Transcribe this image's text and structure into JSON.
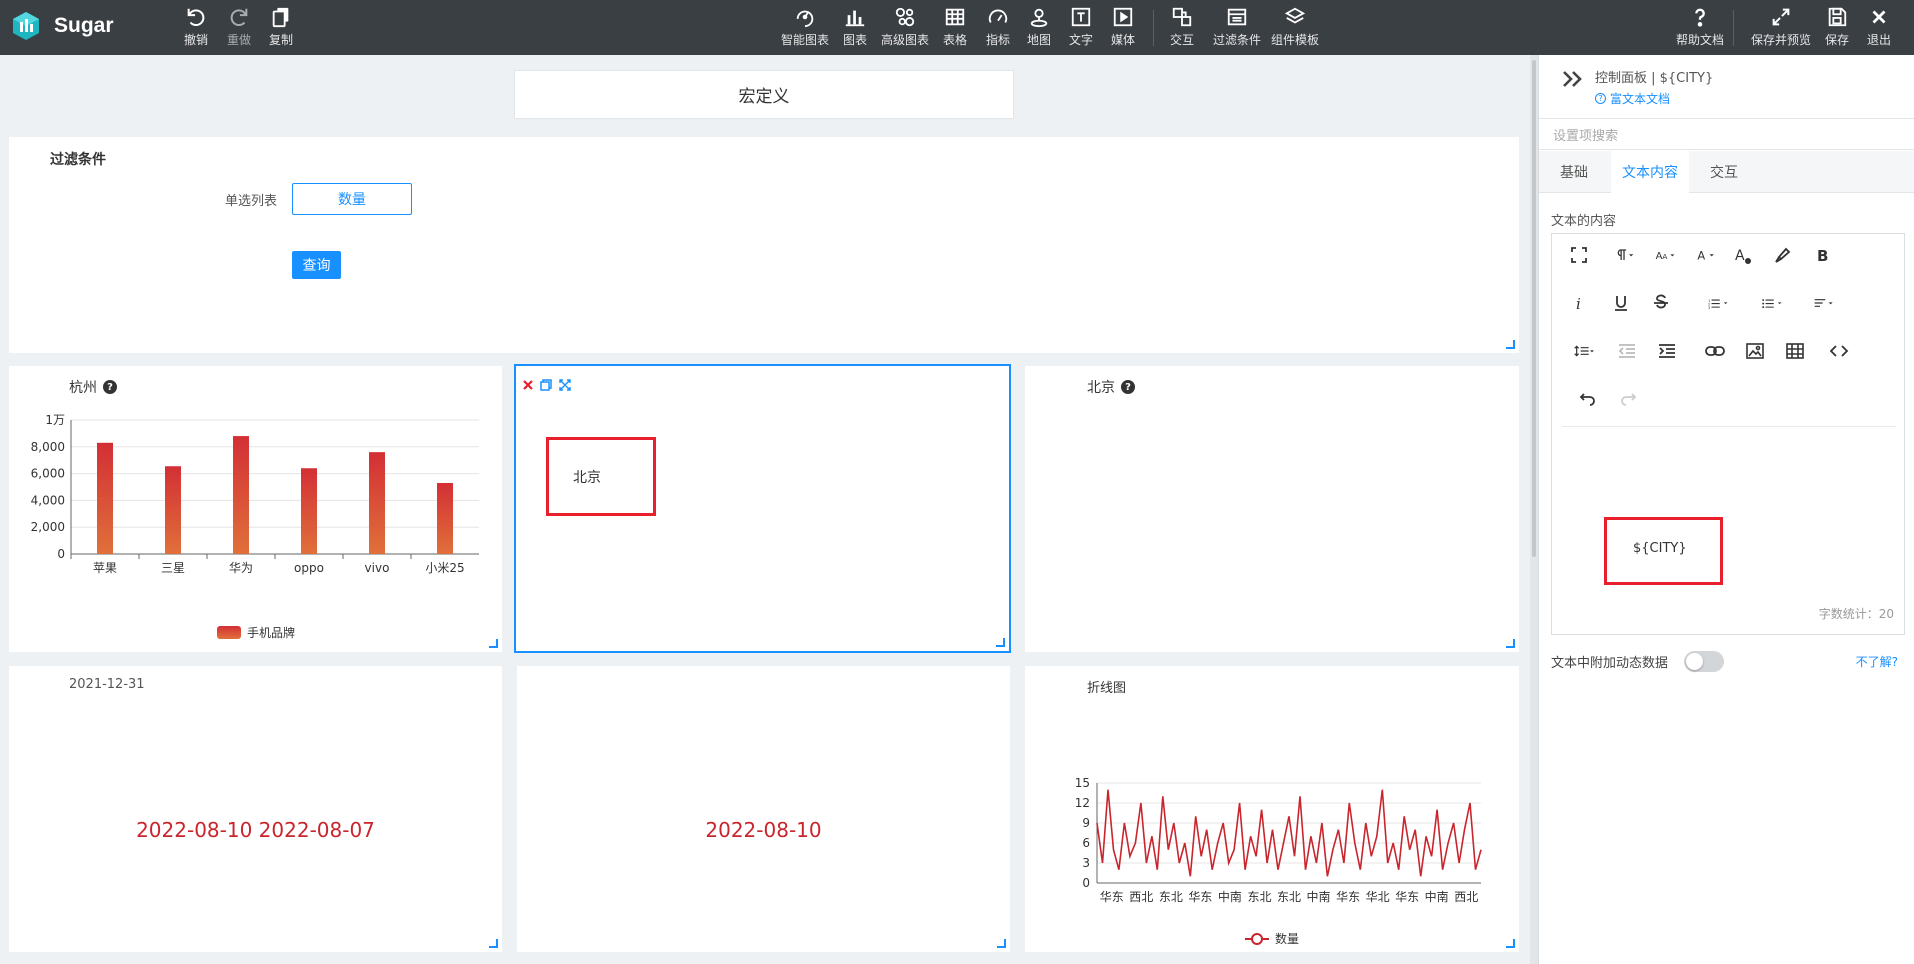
{
  "app": {
    "brand": "Sugar"
  },
  "toolbar": {
    "left": [
      {
        "label": "撤销",
        "icon": "undo-icon"
      },
      {
        "label": "重做",
        "icon": "redo-icon"
      },
      {
        "label": "复制",
        "icon": "copy-icon"
      }
    ],
    "center": [
      {
        "label": "智能图表",
        "icon": "smart-chart-icon"
      },
      {
        "label": "图表",
        "icon": "bar-chart-icon"
      },
      {
        "label": "高级图表",
        "icon": "advanced-chart-icon"
      },
      {
        "label": "表格",
        "icon": "table-icon"
      },
      {
        "label": "指标",
        "icon": "gauge-icon"
      },
      {
        "label": "地图",
        "icon": "map-pin-icon"
      },
      {
        "label": "文字",
        "icon": "text-icon"
      },
      {
        "label": "媒体",
        "icon": "media-icon"
      },
      {
        "label": "交互",
        "icon": "interaction-icon"
      },
      {
        "label": "过滤条件",
        "icon": "filter-icon"
      },
      {
        "label": "组件模板",
        "icon": "template-icon"
      }
    ],
    "right": [
      {
        "label": "帮助文档",
        "icon": "help-icon"
      },
      {
        "label": "保存并预览",
        "icon": "expand-icon"
      },
      {
        "label": "保存",
        "icon": "save-icon"
      },
      {
        "label": "退出",
        "icon": "close-icon"
      }
    ]
  },
  "canvas": {
    "macro_title": "宏定义",
    "filter": {
      "title": "过滤条件",
      "select_label": "单选列表",
      "select_value": "数量",
      "query_button": "查询"
    },
    "hangzhou": {
      "title": "杭州"
    },
    "text_card": {
      "content": "北京"
    },
    "beijing": {
      "title": "北京"
    },
    "date_card": {
      "title": "2021-12-31",
      "value": "2022-08-10 2022-08-07"
    },
    "date_card2": {
      "value": "2022-08-10"
    },
    "line_card": {
      "title": "折线图"
    }
  },
  "chart_data": [
    {
      "type": "bar",
      "categories": [
        "苹果",
        "三星",
        "华为",
        "oppo",
        "vivo",
        "小米25"
      ],
      "series": [
        {
          "name": "手机品牌",
          "values": [
            8300,
            6550,
            8800,
            6400,
            7600,
            5300
          ]
        }
      ],
      "ylim": [
        0,
        10000
      ],
      "yticks": [
        "0",
        "2,000",
        "4,000",
        "6,000",
        "8,000",
        "1万"
      ],
      "legend": "bottom",
      "color": "#d9383a"
    },
    {
      "type": "line",
      "categories": [
        "华东",
        "西北",
        "东北",
        "华东",
        "中南",
        "东北",
        "东北",
        "中南",
        "华东",
        "华北",
        "华东",
        "中南",
        "西北"
      ],
      "series": [
        {
          "name": "数量",
          "values": [
            9,
            3,
            14,
            5,
            2,
            9,
            4,
            6,
            12,
            3,
            7,
            2,
            13,
            5,
            9,
            3,
            6,
            1,
            10,
            4,
            8,
            2,
            6,
            9,
            3,
            5,
            12,
            2,
            7,
            4,
            11,
            3,
            8,
            2,
            6,
            10,
            4,
            13,
            2,
            7,
            3,
            9,
            1,
            5,
            8,
            3,
            12,
            6,
            2,
            9,
            4,
            7,
            14,
            3,
            6,
            2,
            10,
            5,
            8,
            1,
            7,
            4,
            11,
            2,
            6,
            9,
            3,
            8,
            12,
            2,
            5
          ]
        }
      ],
      "ylim": [
        0,
        15
      ],
      "yticks": [
        "0",
        "3",
        "6",
        "9",
        "12",
        "15"
      ],
      "legend": "bottom",
      "color": "#c9252d"
    }
  ],
  "panel": {
    "title": "控制面板 | ${CITY}",
    "doc_link": "富文本文档",
    "search_placeholder": "设置项搜索",
    "tabs": [
      "基础",
      "文本内容",
      "交互"
    ],
    "active_tab": "文本内容",
    "section_label": "文本的内容",
    "editor_content": "${CITY}",
    "char_count": "字数统计：20",
    "dynamic_label": "文本中附加动态数据",
    "help_link": "不了解?"
  }
}
